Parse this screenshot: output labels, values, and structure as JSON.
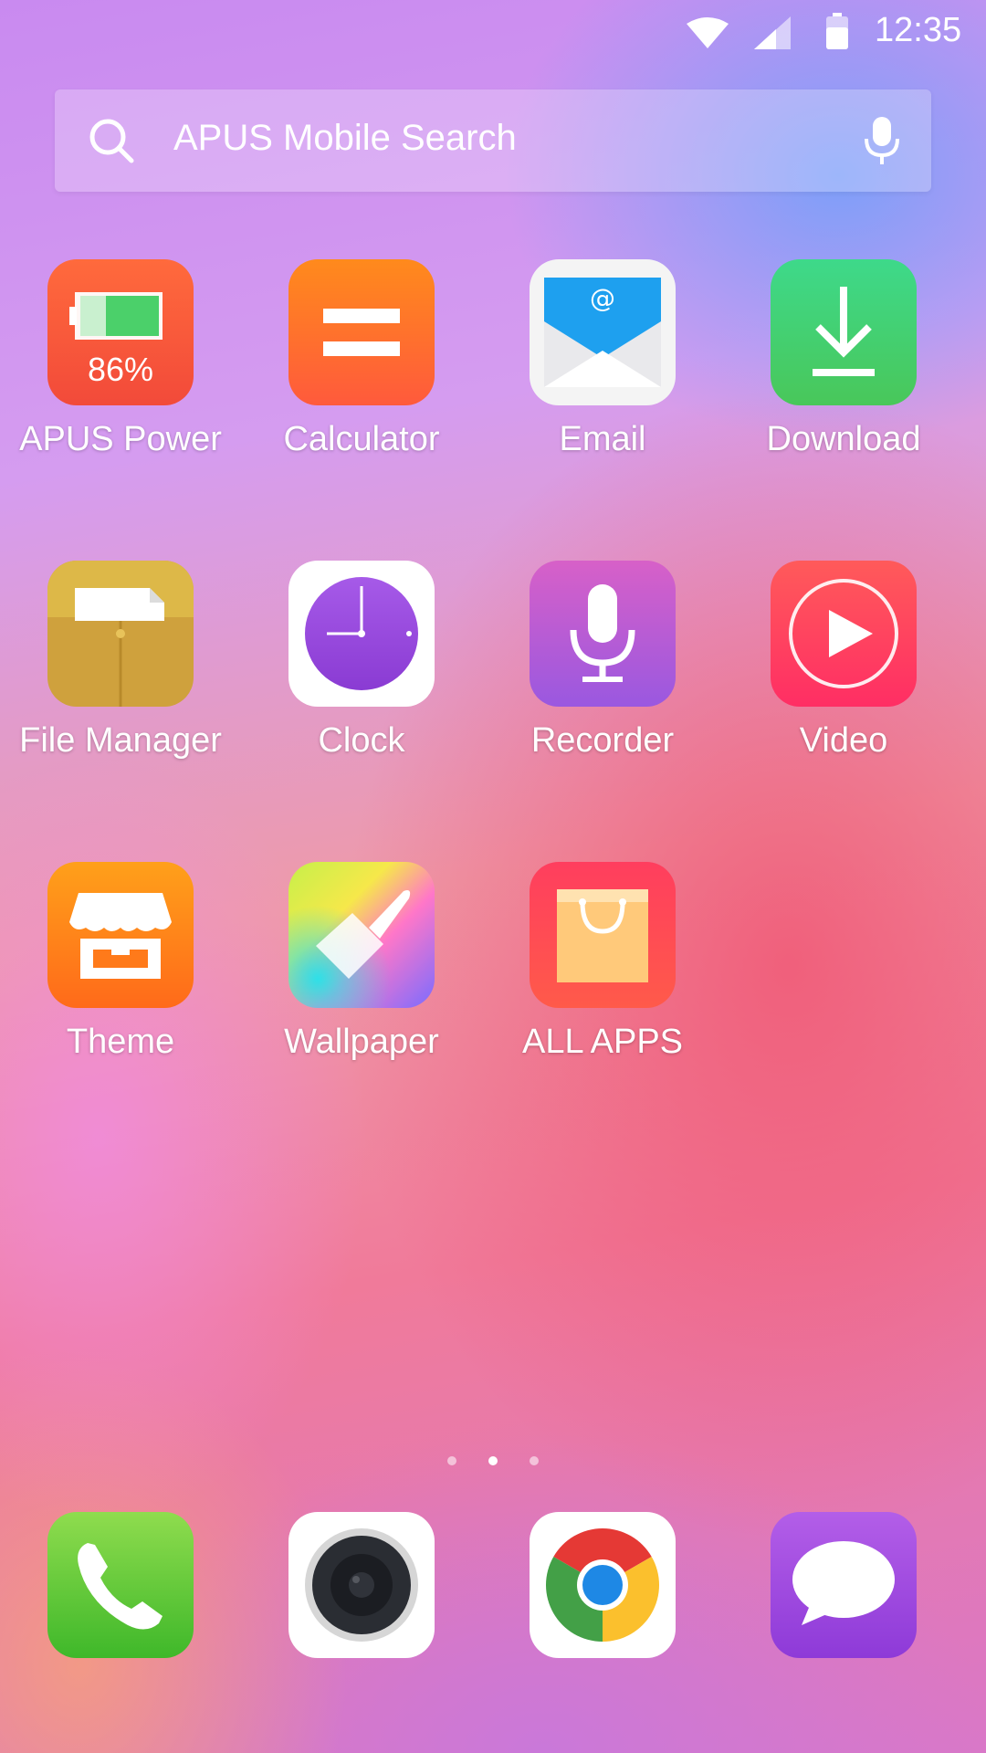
{
  "status_bar": {
    "time": "12:35"
  },
  "search": {
    "placeholder": "APUS Mobile Search"
  },
  "apps": [
    {
      "label": "APUS Power",
      "icon": "battery-app-icon",
      "badge": "86%"
    },
    {
      "label": "Calculator",
      "icon": "calculator-icon"
    },
    {
      "label": "Email",
      "icon": "email-icon"
    },
    {
      "label": "Download",
      "icon": "download-icon"
    },
    {
      "label": "File Manager",
      "icon": "folder-icon"
    },
    {
      "label": "Clock",
      "icon": "clock-icon"
    },
    {
      "label": "Recorder",
      "icon": "microphone-icon"
    },
    {
      "label": "Video",
      "icon": "play-icon"
    },
    {
      "label": "Theme",
      "icon": "store-icon"
    },
    {
      "label": "Wallpaper",
      "icon": "brush-icon"
    },
    {
      "label": "ALL APPS",
      "icon": "shopping-bag-icon"
    }
  ],
  "page_indicator": {
    "pages": 3,
    "active": 2
  },
  "dock": [
    {
      "icon": "phone-icon"
    },
    {
      "icon": "camera-icon"
    },
    {
      "icon": "chrome-icon"
    },
    {
      "icon": "messages-icon"
    }
  ],
  "colors": {
    "power": "#f6623c",
    "calculator": "#ff6a3a",
    "download": "#3fd16d",
    "recorder": "#b054e0",
    "video": "#ff3c63",
    "theme": "#ff7a1a",
    "all_apps": "#ff4a5a",
    "phone": "#5fcb3f",
    "messages": "#a054e6"
  }
}
